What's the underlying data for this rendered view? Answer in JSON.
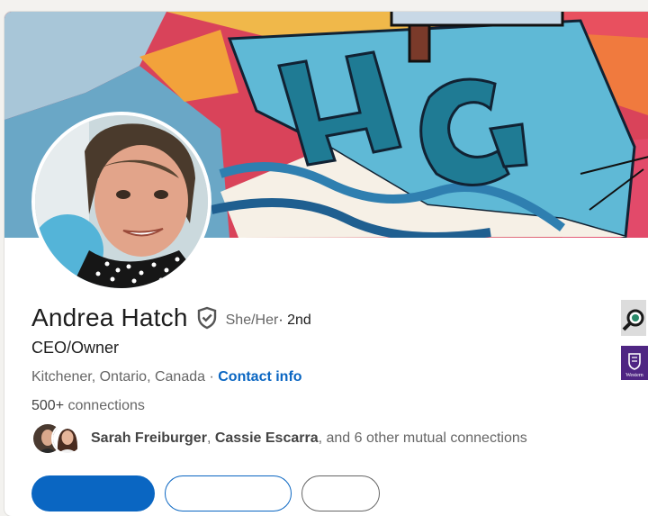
{
  "profile": {
    "name": "Andrea Hatch",
    "pronouns": "She/Her",
    "degree": " · 2nd",
    "headline": "CEO/Owner",
    "location": "Kitchener, Ontario, Canada",
    "location_separator": " · ",
    "contact_info_label": "Contact info",
    "connections_count": "500+",
    "connections_label": " connections"
  },
  "mutual": {
    "person_1": "Sarah Freiburger",
    "separator": ", ",
    "person_2": "Cassie Escarra",
    "rest": ", and 6 other mutual connections"
  },
  "banner": {
    "text_letters": "HC"
  },
  "side": {
    "school_abbrev": "Western"
  },
  "icons": {
    "verified": "verified-shield-icon"
  },
  "colors": {
    "accent": "#0a66c2",
    "background": "#f3f2ef",
    "card": "#ffffff"
  }
}
